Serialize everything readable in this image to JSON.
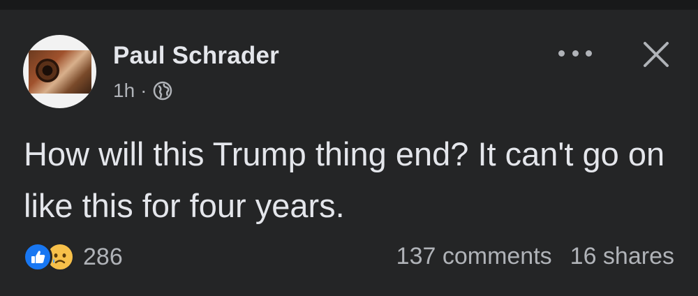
{
  "post": {
    "author": "Paul Schrader",
    "time": "1h",
    "separator": "·",
    "privacy_icon": "globe-icon",
    "text": "How will this Trump thing end? It can't go on like this for four years."
  },
  "header_actions": {
    "more_icon": "more-options-icon",
    "close_icon": "close-icon"
  },
  "reactions": {
    "types": [
      "like",
      "sad"
    ],
    "count": "286"
  },
  "engagement": {
    "comments": "137 comments",
    "shares": "16 shares"
  },
  "colors": {
    "background": "#242526",
    "primary_text": "#e4e6eb",
    "secondary_text": "#b0b3b8",
    "like_blue": "#1877f2",
    "sad_yellow": "#f7c04a"
  }
}
